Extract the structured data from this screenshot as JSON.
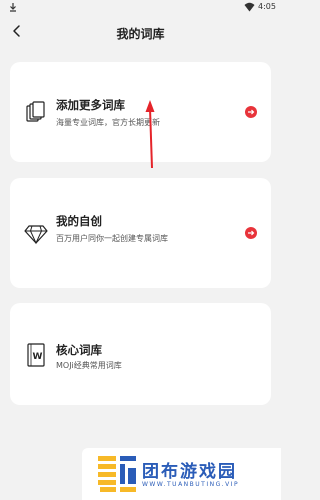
{
  "status_bar": {
    "time": "4:05"
  },
  "header": {
    "title": "我的词库"
  },
  "cards": [
    {
      "name": "添加更多词库",
      "desc": "海量专业词库，官方长期更新"
    },
    {
      "name": "我的自创",
      "desc": "百万用户同你一起创建专属词库"
    },
    {
      "name": "核心词库",
      "desc": "MOJi经典常用词库"
    }
  ],
  "colors": {
    "accent": "#e8333a",
    "watermark": "#2a5cb8"
  },
  "watermark": {
    "text": "团布游戏园",
    "sub": "WWW.TUANBUTING.VIP"
  }
}
